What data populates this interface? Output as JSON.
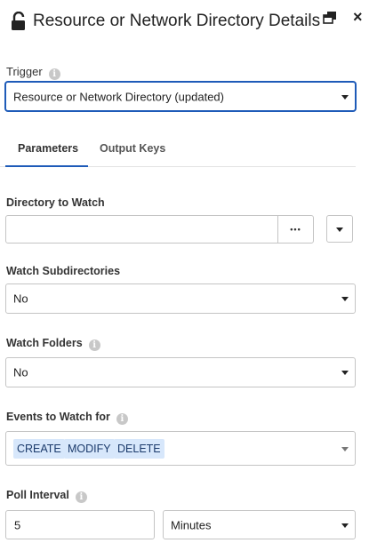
{
  "header": {
    "title": "Resource or Network Directory Details",
    "lock_icon": "unlocked-padlock-icon",
    "popout_icon": "popout-window-icon",
    "close_glyph": "×"
  },
  "trigger": {
    "label": "Trigger",
    "value": "Resource or Network Directory (updated)"
  },
  "tabs": [
    {
      "label": "Parameters",
      "active": true
    },
    {
      "label": "Output Keys",
      "active": false
    }
  ],
  "directory": {
    "label": "Directory to Watch",
    "value": "",
    "browse_label": "•••"
  },
  "watch_subdirectories": {
    "label": "Watch Subdirectories",
    "value": "No"
  },
  "watch_folders": {
    "label": "Watch Folders",
    "value": "No"
  },
  "events": {
    "label": "Events to Watch for",
    "selected": [
      "CREATE",
      "MODIFY",
      "DELETE"
    ]
  },
  "poll_interval": {
    "label": "Poll Interval",
    "value": "5",
    "unit": "Minutes"
  },
  "colors": {
    "accent": "#1e5bb8",
    "chip_bg": "#d7e7fb",
    "border": "#c4c4c4"
  }
}
